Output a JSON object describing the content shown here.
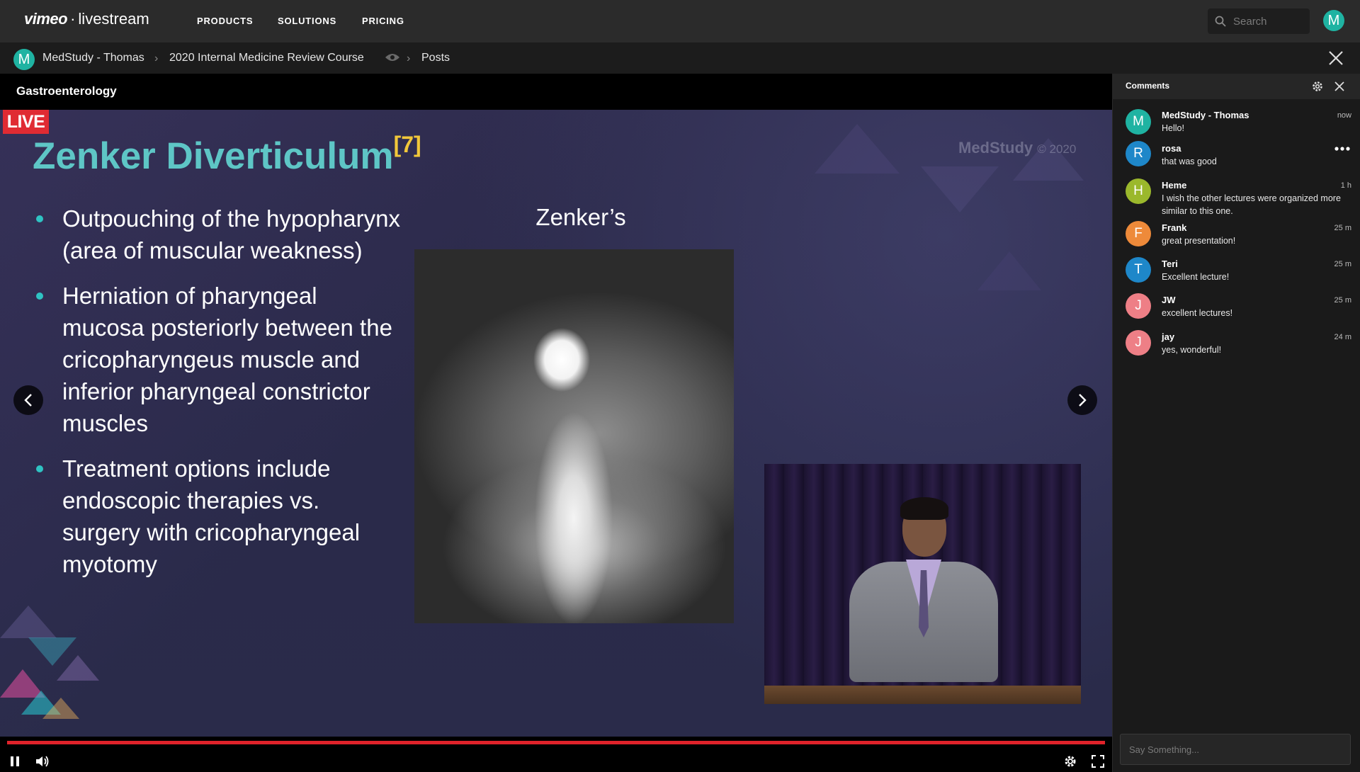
{
  "header": {
    "logo_main": "vimeo",
    "logo_dot": "·",
    "logo_sub": "livestream",
    "nav": [
      "PRODUCTS",
      "SOLUTIONS",
      "PRICING"
    ],
    "search_placeholder": "Search",
    "user_initial": "M"
  },
  "breadcrumb": {
    "initial": "M",
    "items": [
      "MedStudy - Thomas",
      "2020 Internal Medicine Review Course",
      "Posts"
    ],
    "separator": "›"
  },
  "stage": {
    "title": "Gastroenterology",
    "live_label": "LIVE",
    "slide": {
      "title": "Zenker Diverticulum",
      "title_ref": "[7]",
      "watermark": "MedStudy",
      "watermark_year": "© 2020",
      "bullets": [
        "Outpouching of the hypopharynx (area of muscular weakness)",
        "Herniation of pharyngeal mucosa posteriorly between the cricopharyngeus muscle and inferior pharyngeal constrictor muscles",
        "Treatment options include endoscopic therapies vs. surgery with cricopharyngeal myotomy"
      ],
      "image_caption": "Zenker’s"
    },
    "progress": 1.0
  },
  "comments": {
    "title": "Comments",
    "input_placeholder": "Say Something...",
    "items": [
      {
        "initial": "M",
        "name": "MedStudy - Thomas",
        "text": "Hello!",
        "time": "now",
        "color": "#1fb3a2"
      },
      {
        "initial": "R",
        "name": "rosa",
        "text": "that was good",
        "time": "",
        "color": "#1e87c9"
      },
      {
        "initial": "H",
        "name": "Heme",
        "text": "I wish the other lectures were organized more similar to this one.",
        "time": "1 h",
        "color": "#9bb82c"
      },
      {
        "initial": "F",
        "name": "Frank",
        "text": "great presentation!",
        "time": "25 m",
        "color": "#ee8a3a"
      },
      {
        "initial": "T",
        "name": "Teri",
        "text": "Excellent lecture!",
        "time": "25 m",
        "color": "#1e87c9"
      },
      {
        "initial": "J",
        "name": "JW",
        "text": "excellent lectures!",
        "time": "25 m",
        "color": "#ee7f86"
      },
      {
        "initial": "J",
        "name": "jay",
        "text": "yes, wonderful!",
        "time": "24 m",
        "color": "#ee7f86"
      }
    ]
  },
  "colors": {
    "accent_teal": "#1fb3a2",
    "live_red": "#e02b33",
    "title_teal": "#5ec6c6",
    "ref_yellow": "#f2c83a"
  }
}
